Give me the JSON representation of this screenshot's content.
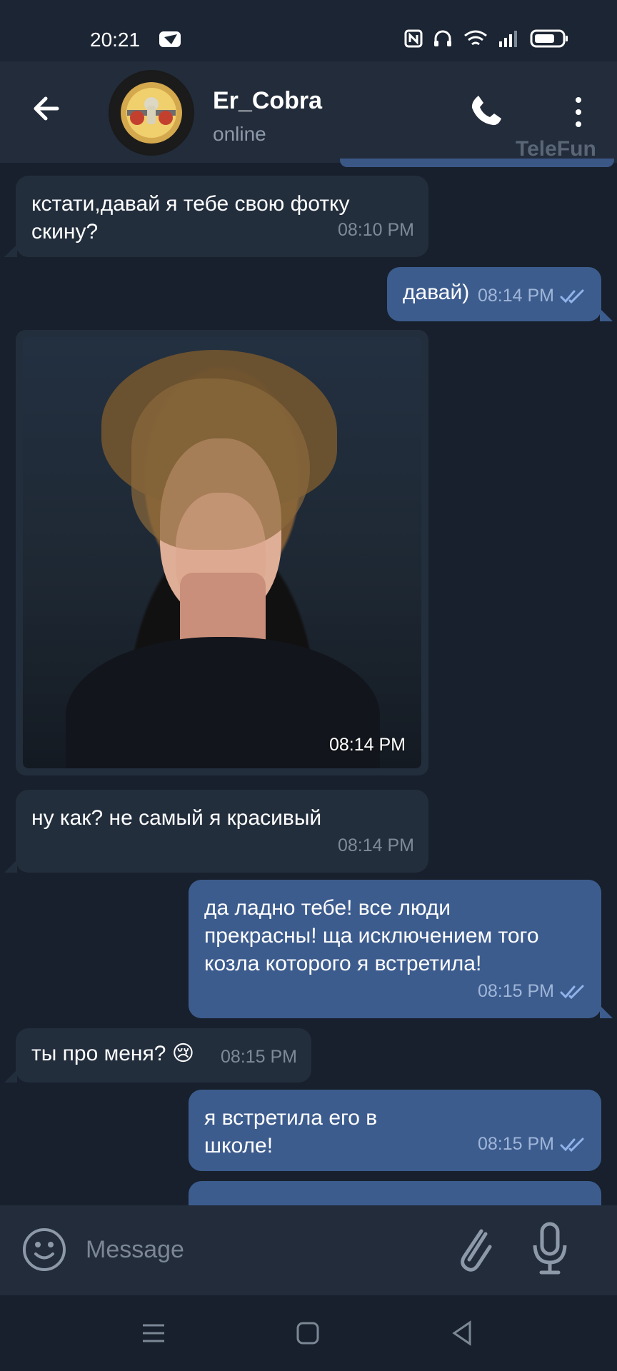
{
  "status_bar": {
    "time": "20:21"
  },
  "header": {
    "contact_name": "Er_Cobra",
    "status": "online",
    "watermark": "TeleFun"
  },
  "messages": [
    {
      "text": "кстати,давай я тебе свою фотку скину?",
      "time": "08:10 PM",
      "direction": "in"
    },
    {
      "text": "давай)",
      "time": "08:14 PM",
      "direction": "out"
    },
    {
      "type": "photo",
      "time": "08:14 PM",
      "direction": "in"
    },
    {
      "text": "ну как? не самый я красивый",
      "time": "08:14 PM",
      "direction": "in"
    },
    {
      "text": "да ладно тебе! все люди прекрасны! ща исключением того козла которого я встретила!",
      "time": "08:15 PM",
      "direction": "out"
    },
    {
      "text": "ты про меня? 😢",
      "time": "08:15 PM",
      "direction": "in"
    },
    {
      "text": "я встретила его в школе!",
      "time": "08:15 PM",
      "direction": "out"
    }
  ],
  "input": {
    "placeholder": "Message"
  },
  "colors": {
    "background": "#17202c",
    "header": "#222c3b",
    "incoming_bubble": "#232e3d",
    "outgoing_bubble": "#3d5c8e",
    "accent": "#8fb3ea"
  },
  "icons": [
    "back-arrow-icon",
    "avatar-logo-icon",
    "phone-icon",
    "more-vertical-icon",
    "emoji-icon",
    "attach-icon",
    "microphone-icon",
    "read-check-icon",
    "menu-icon",
    "home-icon",
    "back-icon"
  ]
}
